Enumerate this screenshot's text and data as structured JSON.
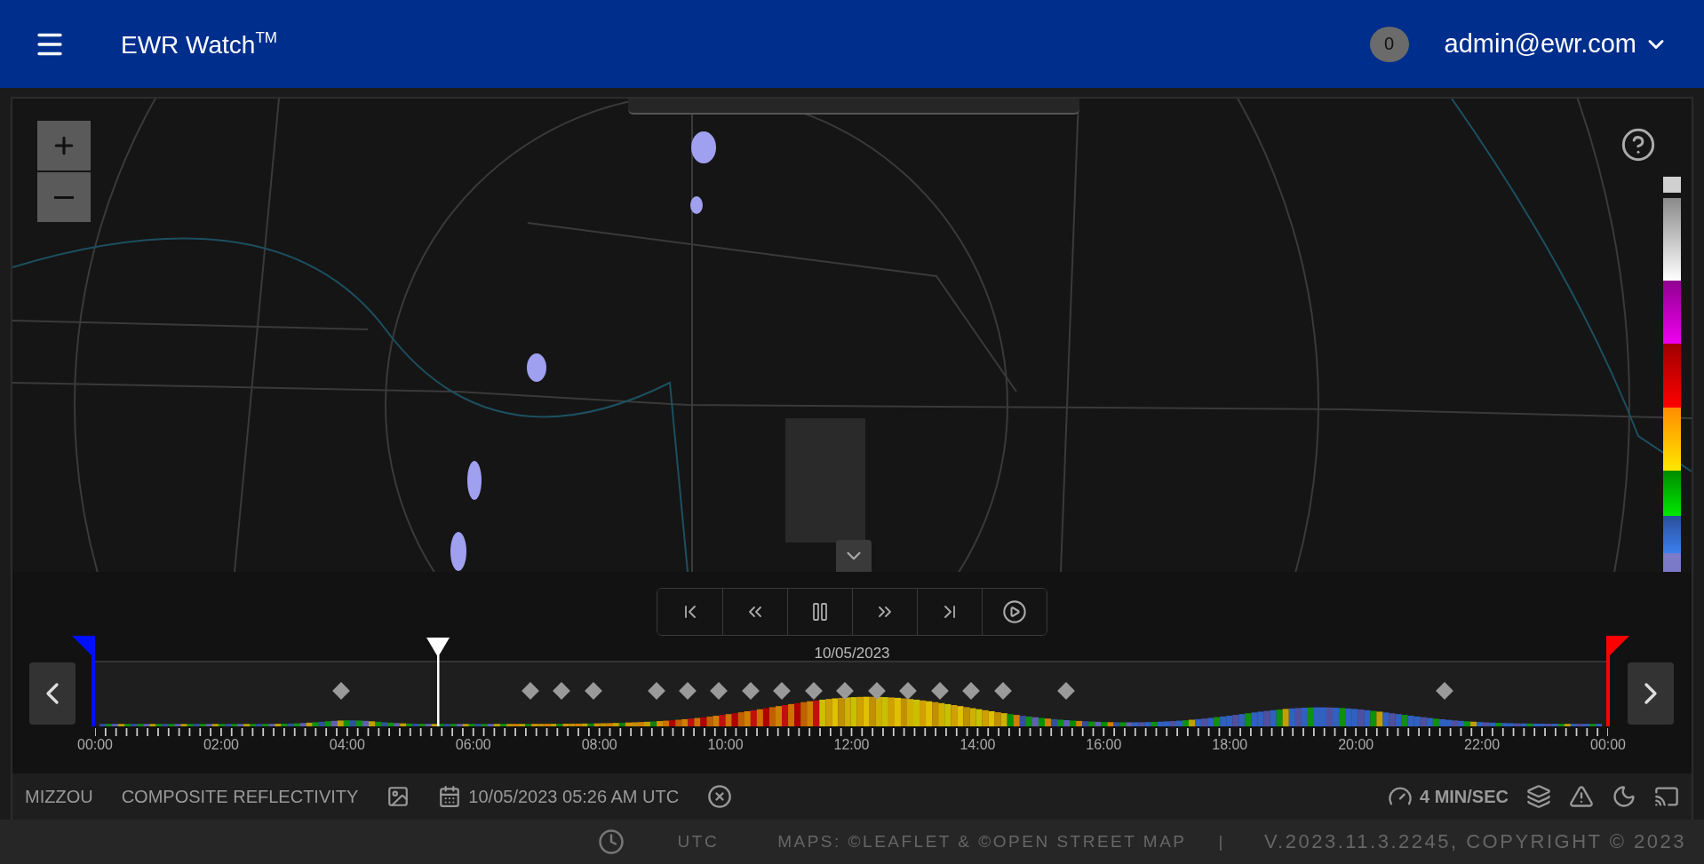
{
  "header": {
    "title": "EWR Watch$^{TM}$",
    "notification_count": "0",
    "user": "admin@ewr.com"
  },
  "playback": {
    "buttons": [
      {
        "kind": "first"
      },
      {
        "kind": "rewind"
      },
      {
        "kind": "pause"
      },
      {
        "kind": "forward"
      },
      {
        "kind": "last"
      },
      {
        "kind": "play"
      }
    ]
  },
  "timeline": {
    "date": "10/05/2023",
    "level": 0.2265,
    "ticks": [
      "00:00",
      "02:00",
      "04:00",
      "06:00",
      "08:00",
      "10:00",
      "12:00",
      "14:00",
      "16:00",
      "18:00",
      "20:00",
      "22:00",
      "00:00"
    ]
  },
  "status_bar": {
    "site": "MIZZOU",
    "product": "COMPOSITE REFLECTIVITY",
    "datetime": "10/05/2023 05:26 AM UTC",
    "speed": "4 MIN/SEC"
  },
  "footer": {
    "timezone": "UTC",
    "attribution": "MAPS: ©LEAFLET & ©OPEN STREET MAP",
    "separator": "|",
    "version": "V.2023.11.3.2245, COPYRIGHT © 2023"
  }
}
